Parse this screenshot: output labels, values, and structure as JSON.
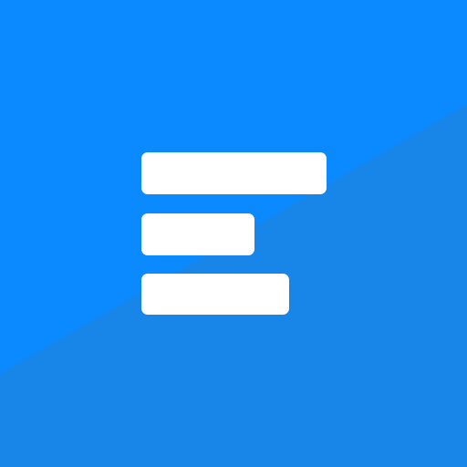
{
  "app_icon": {
    "icon_name": "bars-logo-icon",
    "colors": {
      "background_primary": "#0A8AFE",
      "background_shadow": "#1786E8",
      "bars": "#FFFFFF"
    }
  }
}
